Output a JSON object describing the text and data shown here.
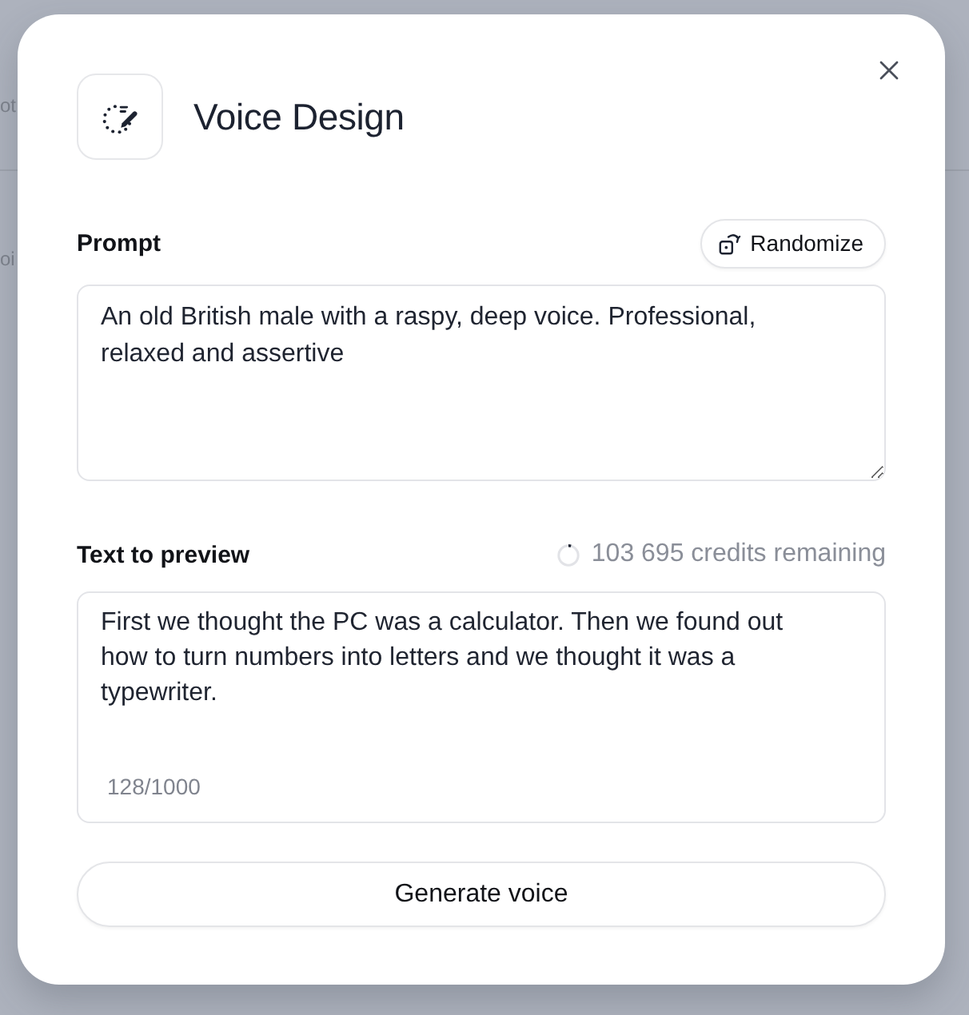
{
  "backdrop": {
    "texts": [
      "ot",
      "oi"
    ]
  },
  "dialog": {
    "title": "Voice Design",
    "prompt": {
      "label": "Prompt",
      "randomize_button": "Randomize",
      "value": "An old British male with a raspy, deep voice. Professional, relaxed and assertive"
    },
    "preview": {
      "label": "Text to preview",
      "credits": "103 695 credits remaining",
      "value": "First we thought the PC was a calculator. Then we found out how to turn numbers into letters and we thought it was a typewriter.",
      "counter": "128/1000"
    },
    "generate_button": "Generate voice"
  }
}
